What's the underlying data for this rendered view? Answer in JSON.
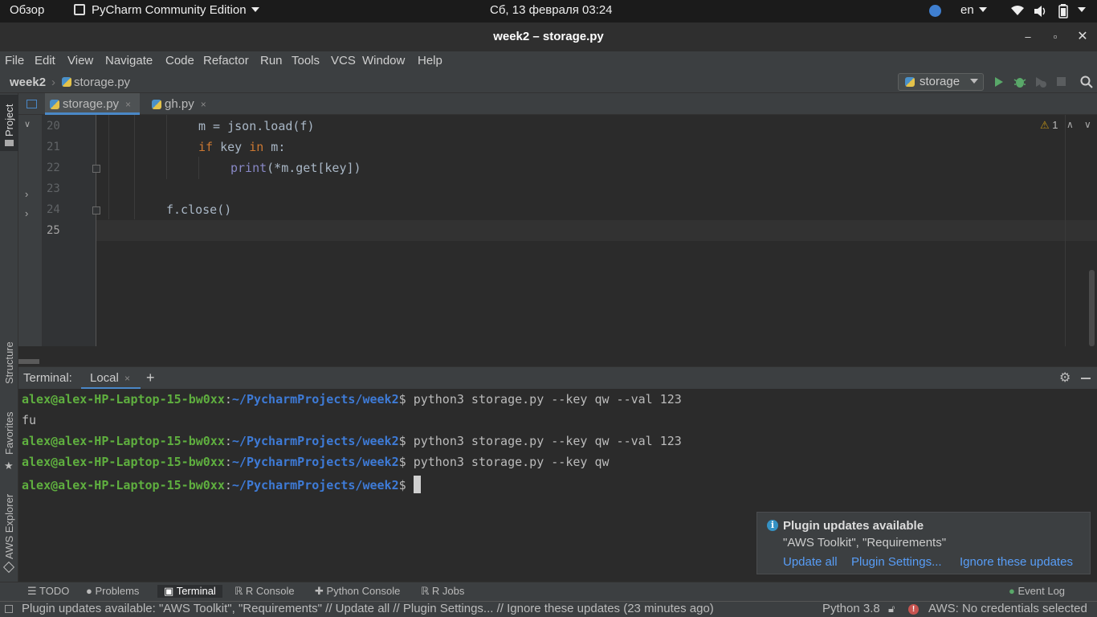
{
  "gnome": {
    "activities": "Обзор",
    "app_name": "PyCharm Community Edition",
    "datetime": "Сб, 13 февраля  03:24",
    "language": "en"
  },
  "window": {
    "title": "week2 – storage.py"
  },
  "menu": [
    "File",
    "Edit",
    "View",
    "Navigate",
    "Code",
    "Refactor",
    "Run",
    "Tools",
    "VCS",
    "Window",
    "Help"
  ],
  "breadcrumb": {
    "project": "week2",
    "file": "storage.py"
  },
  "run_config": "storage",
  "left_tools": [
    "Project",
    "Structure",
    "Favorites",
    "AWS Explorer"
  ],
  "tabs": [
    {
      "label": "storage.py",
      "close": "×"
    },
    {
      "label": "gh.py",
      "close": "×"
    }
  ],
  "editor": {
    "lines": [
      "20",
      "21",
      "22",
      "23",
      "24",
      "25"
    ],
    "code": {
      "l20": "m = json.load(f)",
      "l21_kw1": "if",
      "l21_mid": " key ",
      "l21_kw2": "in",
      "l21_end": " m:",
      "l22_fn": "print",
      "l22_rest": "(*m.get[key])",
      "l24": "f.close()"
    },
    "inspection_count": "1"
  },
  "terminal": {
    "label": "Terminal:",
    "tab": "Local",
    "tab_close": "×",
    "add": "+",
    "user": "alex@alex-HP-Laptop-15-bw0xx",
    "sep": ":",
    "path": "~/PycharmProjects/week2",
    "prompt": "$ ",
    "cmd1": "python3 storage.py --key qw --val 123",
    "out1": "fu",
    "cmd2": "python3 storage.py --key qw --val 123",
    "cmd3": "python3 storage.py --key qw"
  },
  "notification": {
    "title": "Plugin updates available",
    "body": "\"AWS Toolkit\", \"Requirements\"",
    "link_update": "Update all",
    "link_settings": "Plugin Settings...",
    "link_ignore": "Ignore these updates"
  },
  "bottom_tabs": [
    "TODO",
    "Problems",
    "Terminal",
    "R Console",
    "Python Console",
    "R Jobs"
  ],
  "event_log": "Event Log",
  "status": {
    "message": "Plugin updates available: \"AWS Toolkit\", \"Requirements\" // Update all // Plugin Settings... // Ignore these updates (23 minutes ago)",
    "python": "Python 3.8",
    "aws": "AWS: No credentials selected"
  }
}
